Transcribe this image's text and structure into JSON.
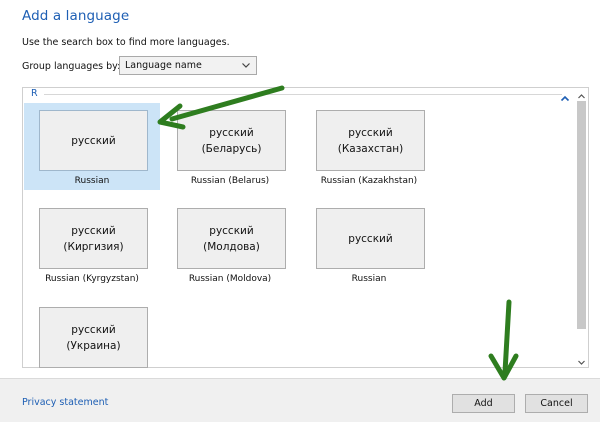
{
  "dialog": {
    "title": "Add a language",
    "hint": "Use the search box to find more languages.",
    "group_by_label": "Group languages by:",
    "group_by_value": "Language name"
  },
  "list": {
    "group_letter": "R",
    "tiles": [
      {
        "native": "русский",
        "label": "Russian",
        "selected": true
      },
      {
        "native": "русский\n(Беларусь)",
        "label": "Russian (Belarus)",
        "selected": false
      },
      {
        "native": "русский\n(Казахстан)",
        "label": "Russian (Kazakhstan)",
        "selected": false
      },
      {
        "native": "русский\n(Киргизия)",
        "label": "Russian (Kyrgyzstan)",
        "selected": false
      },
      {
        "native": "русский\n(Молдова)",
        "label": "Russian (Moldova)",
        "selected": false
      },
      {
        "native": "русский",
        "label": "Russian",
        "selected": false
      },
      {
        "native": "русский\n(Украина)",
        "label": "Russian (Ukraine)",
        "selected": false
      }
    ]
  },
  "footer": {
    "privacy": "Privacy statement",
    "add": "Add",
    "cancel": "Cancel"
  },
  "icons": {
    "dropdown": "chevron-down-icon",
    "collapse": "chevron-up-icon",
    "scroll_up": "scroll-up-arrow",
    "scroll_down": "scroll-down-arrow",
    "annotation": "green-arrow"
  },
  "colors": {
    "accent": "#1e5fb4",
    "selected_tile": "#cce4f7",
    "annotation_arrow": "#2e7d1f"
  }
}
